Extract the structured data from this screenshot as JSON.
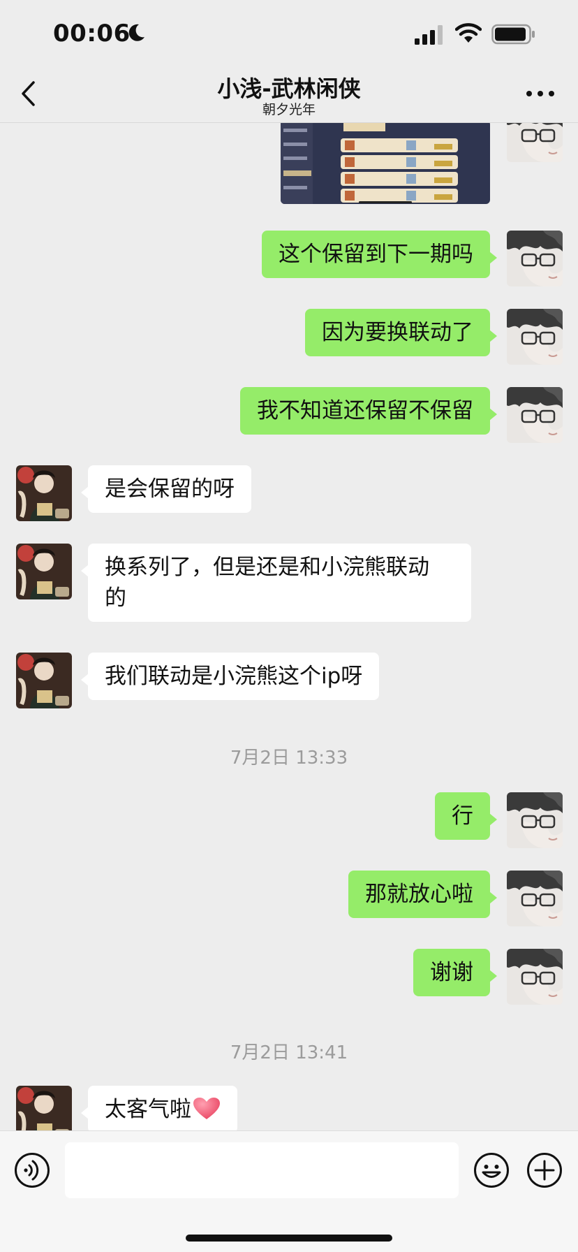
{
  "status_bar": {
    "time": "00:06"
  },
  "header": {
    "title": "小浅-武林闲侠",
    "subtitle": "朝夕光年"
  },
  "messages": [
    {
      "from": "me",
      "text": "这个保留到下一期吗"
    },
    {
      "from": "me",
      "text": "因为要换联动了"
    },
    {
      "from": "me",
      "text": "我不知道还保留不保留"
    },
    {
      "from": "them",
      "text": "是会保留的呀"
    },
    {
      "from": "them",
      "text_line1": "换系列了，但是还是和小浣熊联动",
      "text_line2": "的"
    },
    {
      "from": "them",
      "text": "我们联动是小浣熊这个ip呀"
    },
    {
      "from": "me",
      "text": "行"
    },
    {
      "from": "me",
      "text": "那就放心啦"
    },
    {
      "from": "me",
      "text": "谢谢"
    },
    {
      "from": "them",
      "text": "太客气啦"
    }
  ],
  "timestamps": [
    "7月2日 13:33",
    "7月2日 13:41"
  ],
  "colors": {
    "outgoing_bubble": "#95ec69",
    "incoming_bubble": "#ffffff",
    "background": "#ededed"
  },
  "icons": {
    "back": "chevron-left-icon",
    "more": "more-icon",
    "voice": "voice-icon",
    "emoji": "emoji-icon",
    "plus": "plus-icon",
    "heart": "heart-icon"
  }
}
